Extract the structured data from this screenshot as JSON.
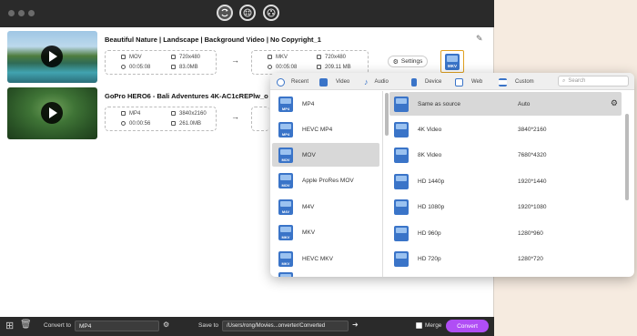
{
  "videos": [
    {
      "title": "Beautiful Nature | Landscape | Background Video | No Copyright_1",
      "checked": "✓",
      "source": {
        "format": "MOV",
        "resolution": "720x480",
        "duration": "00:05:08",
        "size": "83.0MB"
      },
      "output": {
        "format": "MKV",
        "resolution": "720x480",
        "duration": "00:05:08",
        "size": "209.11 MB"
      },
      "settings_label": "Settings",
      "format_badge": "MKV"
    },
    {
      "title": "GoPro HERO6 - Bali Adventures 4K-AC1cREPlw_o",
      "checked": "✓",
      "source": {
        "format": "MP4",
        "resolution": "3840x2160",
        "duration": "00:00:56",
        "size": "261.0MB"
      }
    }
  ],
  "bottom_bar": {
    "convert_to_label": "Convert to",
    "convert_to_value": "MP4",
    "save_to_label": "Save to",
    "save_to_value": "/Users/rong/Movies...onverter/Converted",
    "merge_label": "Merge",
    "convert_button": "Convert"
  },
  "format_panel": {
    "tabs": [
      {
        "label": "Recent",
        "icon": "recent-icon"
      },
      {
        "label": "Video",
        "icon": "video-icon"
      },
      {
        "label": "Audio",
        "icon": "audio-icon"
      },
      {
        "label": "Device",
        "icon": "device-icon"
      },
      {
        "label": "Web",
        "icon": "web-icon"
      },
      {
        "label": "Custom",
        "icon": "custom-icon"
      }
    ],
    "active_tab": "Video",
    "search_placeholder": "Search",
    "formats": [
      {
        "label": "MP4",
        "badge": "MP4"
      },
      {
        "label": "HEVC MP4",
        "badge": "MP4"
      },
      {
        "label": "MOV",
        "badge": "MOV"
      },
      {
        "label": "Apple ProRes MOV",
        "badge": "MOV"
      },
      {
        "label": "M4V",
        "badge": "M4V"
      },
      {
        "label": "MKV",
        "badge": "MKV"
      },
      {
        "label": "HEVC MKV",
        "badge": "MKV"
      }
    ],
    "selected_format": "MOV",
    "presets": [
      {
        "name": "Same as source",
        "resolution": "Auto"
      },
      {
        "name": "4K Video",
        "resolution": "3840*2160"
      },
      {
        "name": "8K Video",
        "resolution": "7680*4320"
      },
      {
        "name": "HD 1440p",
        "resolution": "1920*1440"
      },
      {
        "name": "HD 1080p",
        "resolution": "1920*1080"
      },
      {
        "name": "HD 960p",
        "resolution": "1280*960"
      },
      {
        "name": "HD 720p",
        "resolution": "1280*720"
      }
    ],
    "selected_preset": "Same as source"
  },
  "colors": {
    "accent": "#b04ef5",
    "format_icon": "#3a74c8",
    "selected_row": "#d8d8d8"
  }
}
